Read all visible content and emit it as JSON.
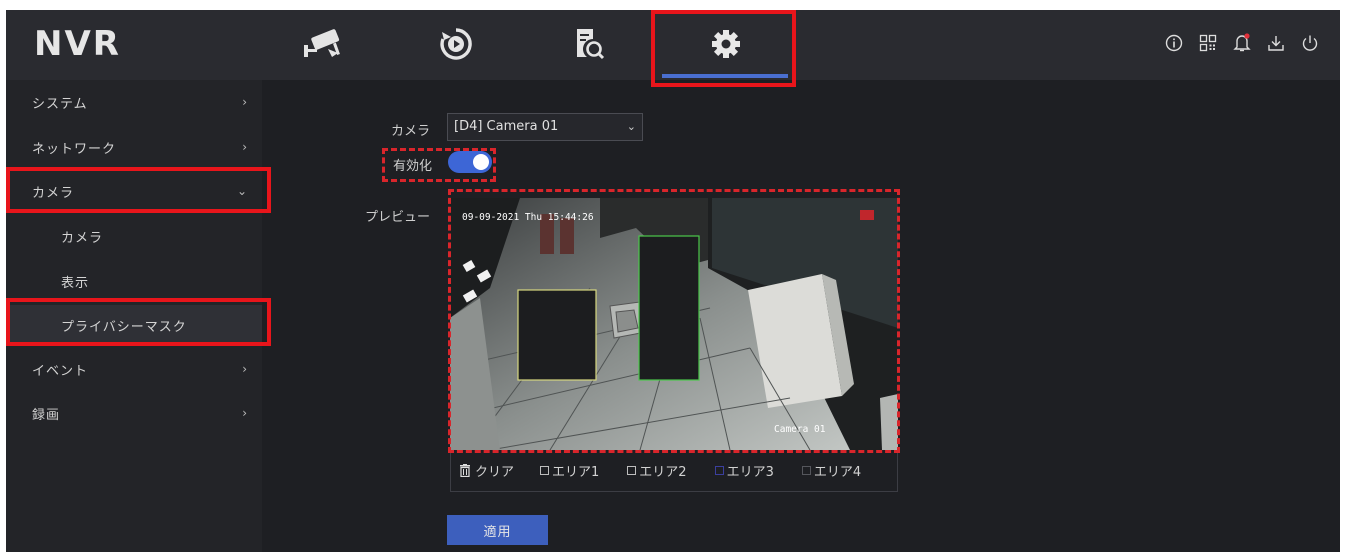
{
  "app": {
    "logo": "NVR"
  },
  "topnav": {
    "items": [
      {
        "icon": "camera-live-view-icon"
      },
      {
        "icon": "playback-icon"
      },
      {
        "icon": "file-search-icon"
      },
      {
        "icon": "settings-gear-icon",
        "active": true
      }
    ],
    "system_icons": [
      "info-icon",
      "qr-code-icon",
      "notification-bell-icon",
      "download-icon",
      "power-icon"
    ]
  },
  "sidebar": {
    "items": [
      {
        "label": "システム",
        "chevron": "›"
      },
      {
        "label": "ネットワーク",
        "chevron": "›"
      },
      {
        "label": "カメラ",
        "chevron": "⌄"
      },
      {
        "label": "カメラ"
      },
      {
        "label": "表示"
      },
      {
        "label": "プライバシーマスク",
        "active": true
      },
      {
        "label": "イベント",
        "chevron": "›"
      },
      {
        "label": "録画",
        "chevron": "›"
      }
    ]
  },
  "form": {
    "camera_label": "カメラ",
    "camera_value": "[D4] Camera 01",
    "enable_label": "有効化",
    "enable_on": true,
    "preview_label": "プレビュー"
  },
  "preview": {
    "timestamp": "09-09-2021 Thu 15:44:26",
    "camera_name": "Camera 01"
  },
  "tools": {
    "clear_label": "クリア",
    "areas": [
      {
        "label": "エリア1",
        "color": "#bdbdbd"
      },
      {
        "label": "エリア2",
        "color": "#bdbdbd"
      },
      {
        "label": "エリア3",
        "color": "#3b3f9e"
      },
      {
        "label": "エリア4",
        "color": "#3a3b40"
      }
    ]
  },
  "apply_label": "適用",
  "colors": {
    "accent": "#3d66d6",
    "highlight": "#e8151b"
  }
}
